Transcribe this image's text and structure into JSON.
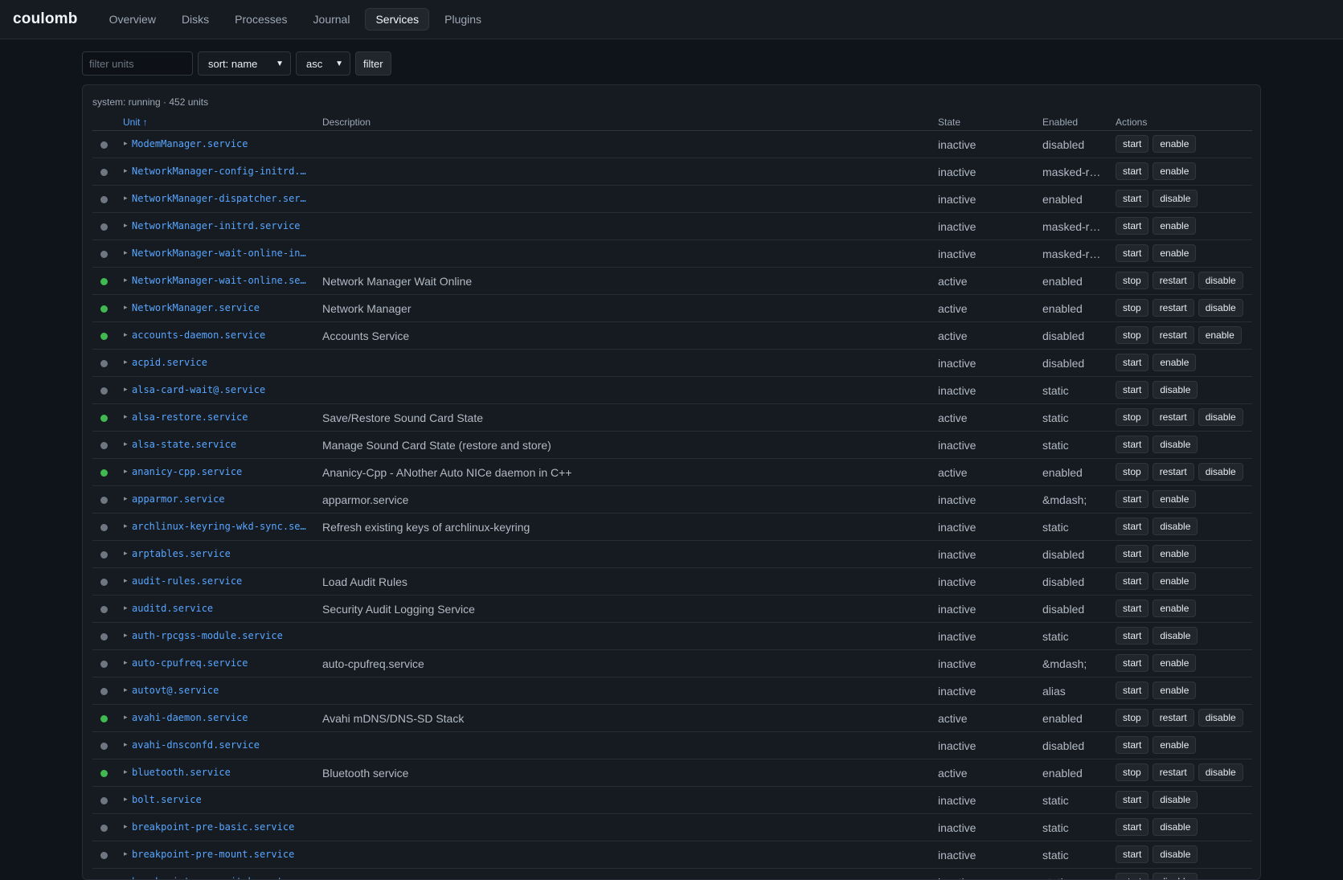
{
  "app": {
    "brand": "coulomb",
    "tabs": [
      {
        "label": "Overview",
        "active": false
      },
      {
        "label": "Disks",
        "active": false
      },
      {
        "label": "Processes",
        "active": false
      },
      {
        "label": "Journal",
        "active": false
      },
      {
        "label": "Services",
        "active": true
      },
      {
        "label": "Plugins",
        "active": false
      }
    ]
  },
  "toolbar": {
    "filter_placeholder": "filter units",
    "filter_value": "",
    "sort_value": "sort: name",
    "order_value": "asc",
    "filter_button": "filter"
  },
  "panel": {
    "summary": "system: running · 452 units",
    "columns": {
      "unit": "Unit ↑",
      "description": "Description",
      "state": "State",
      "enabled": "Enabled",
      "actions": "Actions"
    }
  },
  "colors": {
    "active_dot": "#3fb950",
    "inactive_dot": "#6e7681",
    "link": "#58a6ff"
  },
  "units": [
    {
      "name": "ModemManager.service",
      "description": "",
      "state": "inactive",
      "enabled": "disabled",
      "actions": [
        "start",
        "enable"
      ]
    },
    {
      "name": "NetworkManager-config-initrd.se…",
      "description": "",
      "state": "inactive",
      "enabled": "masked-r…",
      "actions": [
        "start",
        "enable"
      ]
    },
    {
      "name": "NetworkManager-dispatcher.servi…",
      "description": "",
      "state": "inactive",
      "enabled": "enabled",
      "actions": [
        "start",
        "disable"
      ]
    },
    {
      "name": "NetworkManager-initrd.service",
      "description": "",
      "state": "inactive",
      "enabled": "masked-r…",
      "actions": [
        "start",
        "enable"
      ]
    },
    {
      "name": "NetworkManager-wait-online-init…",
      "description": "",
      "state": "inactive",
      "enabled": "masked-r…",
      "actions": [
        "start",
        "enable"
      ]
    },
    {
      "name": "NetworkManager-wait-online.serv…",
      "description": "Network Manager Wait Online",
      "state": "active",
      "enabled": "enabled",
      "actions": [
        "stop",
        "restart",
        "disable"
      ]
    },
    {
      "name": "NetworkManager.service",
      "description": "Network Manager",
      "state": "active",
      "enabled": "enabled",
      "actions": [
        "stop",
        "restart",
        "disable"
      ]
    },
    {
      "name": "accounts-daemon.service",
      "description": "Accounts Service",
      "state": "active",
      "enabled": "disabled",
      "actions": [
        "stop",
        "restart",
        "enable"
      ]
    },
    {
      "name": "acpid.service",
      "description": "",
      "state": "inactive",
      "enabled": "disabled",
      "actions": [
        "start",
        "enable"
      ]
    },
    {
      "name": "alsa-card-wait@.service",
      "description": "",
      "state": "inactive",
      "enabled": "static",
      "actions": [
        "start",
        "disable"
      ]
    },
    {
      "name": "alsa-restore.service",
      "description": "Save/Restore Sound Card State",
      "state": "active",
      "enabled": "static",
      "actions": [
        "stop",
        "restart",
        "disable"
      ]
    },
    {
      "name": "alsa-state.service",
      "description": "Manage Sound Card State (restore and store)",
      "state": "inactive",
      "enabled": "static",
      "actions": [
        "start",
        "disable"
      ]
    },
    {
      "name": "ananicy-cpp.service",
      "description": "Ananicy-Cpp - ANother Auto NICe daemon in C++",
      "state": "active",
      "enabled": "enabled",
      "actions": [
        "stop",
        "restart",
        "disable"
      ]
    },
    {
      "name": "apparmor.service",
      "description": "apparmor.service",
      "state": "inactive",
      "enabled": "&mdash;",
      "actions": [
        "start",
        "enable"
      ]
    },
    {
      "name": "archlinux-keyring-wkd-sync.serv…",
      "description": "Refresh existing keys of archlinux-keyring",
      "state": "inactive",
      "enabled": "static",
      "actions": [
        "start",
        "disable"
      ]
    },
    {
      "name": "arptables.service",
      "description": "",
      "state": "inactive",
      "enabled": "disabled",
      "actions": [
        "start",
        "enable"
      ]
    },
    {
      "name": "audit-rules.service",
      "description": "Load Audit Rules",
      "state": "inactive",
      "enabled": "disabled",
      "actions": [
        "start",
        "enable"
      ]
    },
    {
      "name": "auditd.service",
      "description": "Security Audit Logging Service",
      "state": "inactive",
      "enabled": "disabled",
      "actions": [
        "start",
        "enable"
      ]
    },
    {
      "name": "auth-rpcgss-module.service",
      "description": "",
      "state": "inactive",
      "enabled": "static",
      "actions": [
        "start",
        "disable"
      ]
    },
    {
      "name": "auto-cpufreq.service",
      "description": "auto-cpufreq.service",
      "state": "inactive",
      "enabled": "&mdash;",
      "actions": [
        "start",
        "enable"
      ]
    },
    {
      "name": "autovt@.service",
      "description": "",
      "state": "inactive",
      "enabled": "alias",
      "actions": [
        "start",
        "enable"
      ]
    },
    {
      "name": "avahi-daemon.service",
      "description": "Avahi mDNS/DNS-SD Stack",
      "state": "active",
      "enabled": "enabled",
      "actions": [
        "stop",
        "restart",
        "disable"
      ]
    },
    {
      "name": "avahi-dnsconfd.service",
      "description": "",
      "state": "inactive",
      "enabled": "disabled",
      "actions": [
        "start",
        "enable"
      ]
    },
    {
      "name": "bluetooth.service",
      "description": "Bluetooth service",
      "state": "active",
      "enabled": "enabled",
      "actions": [
        "stop",
        "restart",
        "disable"
      ]
    },
    {
      "name": "bolt.service",
      "description": "",
      "state": "inactive",
      "enabled": "static",
      "actions": [
        "start",
        "disable"
      ]
    },
    {
      "name": "breakpoint-pre-basic.service",
      "description": "",
      "state": "inactive",
      "enabled": "static",
      "actions": [
        "start",
        "disable"
      ]
    },
    {
      "name": "breakpoint-pre-mount.service",
      "description": "",
      "state": "inactive",
      "enabled": "static",
      "actions": [
        "start",
        "disable"
      ]
    },
    {
      "name": "breakpoint-pre-switch-root.serv…",
      "description": "",
      "state": "inactive",
      "enabled": "static",
      "actions": [
        "start",
        "disable"
      ]
    }
  ]
}
